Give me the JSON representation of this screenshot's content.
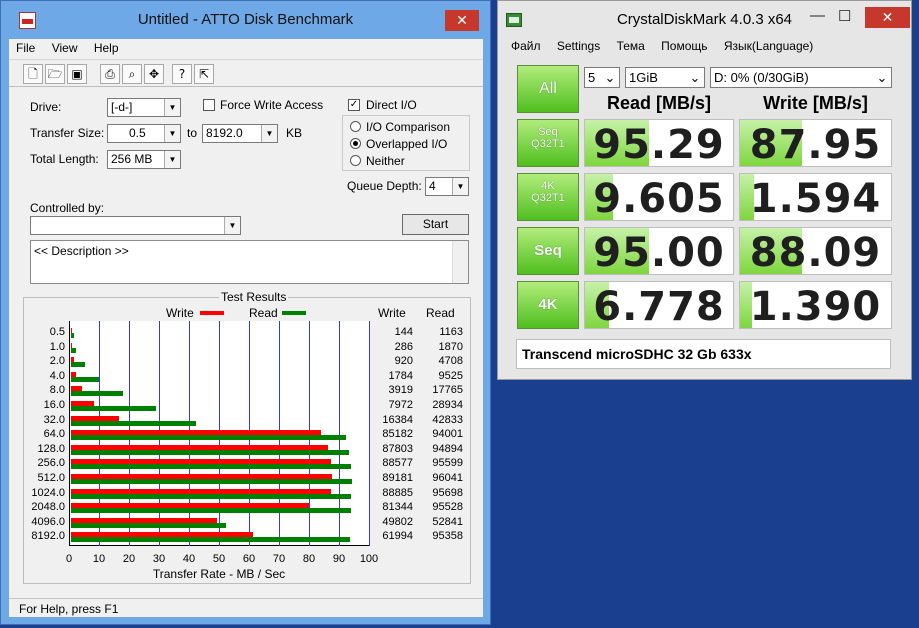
{
  "atto": {
    "title": "Untitled - ATTO Disk Benchmark",
    "close": "✕",
    "menu": [
      "File",
      "View",
      "Help"
    ],
    "toolbar_icons": [
      "new-icon",
      "open-icon",
      "save-icon",
      "print-icon",
      "print-preview-icon",
      "move-icon",
      "help-icon",
      "context-help-icon"
    ],
    "drive_label": "Drive:",
    "drive_value": "[-d-]",
    "transfer_size_label": "Transfer Size:",
    "transfer_from": "0.5",
    "to_label": "to",
    "transfer_to": "8192.0",
    "kb_label": "KB",
    "total_length_label": "Total Length:",
    "total_length_value": "256 MB",
    "force_write_label": "Force Write Access",
    "direct_io_label": "Direct I/O",
    "io_comparison_label": "I/O Comparison",
    "overlapped_io_label": "Overlapped I/O",
    "neither_label": "Neither",
    "queue_depth_label": "Queue Depth:",
    "queue_depth_value": "4",
    "controlled_by_label": "Controlled by:",
    "start_label": "Start",
    "description_text": "<< Description >>",
    "results_title": "Test Results",
    "legend_write": "Write",
    "legend_read": "Read",
    "col_write": "Write",
    "col_read": "Read",
    "xlabel": "Transfer Rate - MB / Sec",
    "status": "For Help, press F1",
    "colors": {
      "write": "#ff0000",
      "read": "#008000",
      "grid": "#3a3ad0"
    }
  },
  "chart_data": {
    "type": "bar",
    "orientation": "horizontal",
    "title": "Test Results",
    "xlabel": "Transfer Rate - MB / Sec",
    "xlim": [
      0,
      100
    ],
    "xticks": [
      "0",
      "10",
      "20",
      "30",
      "40",
      "50",
      "60",
      "70",
      "80",
      "90",
      "100"
    ],
    "categories": [
      "0.5",
      "1.0",
      "2.0",
      "4.0",
      "8.0",
      "16.0",
      "32.0",
      "64.0",
      "128.0",
      "256.0",
      "512.0",
      "1024.0",
      "2048.0",
      "4096.0",
      "8192.0"
    ],
    "series": [
      {
        "name": "Write",
        "color": "#ff0000",
        "values": [
          0.14,
          0.28,
          0.9,
          1.74,
          3.83,
          7.79,
          16.0,
          83.19,
          85.75,
          86.5,
          87.09,
          86.8,
          79.44,
          48.64,
          60.54
        ]
      },
      {
        "name": "Read",
        "color": "#008000",
        "values": [
          1.14,
          1.83,
          4.6,
          9.3,
          17.35,
          28.26,
          41.83,
          91.8,
          92.67,
          93.36,
          93.79,
          93.45,
          93.29,
          51.6,
          93.12
        ]
      }
    ],
    "write_labels": [
      "144",
      "286",
      "920",
      "1784",
      "3919",
      "7972",
      "16384",
      "85182",
      "87803",
      "88577",
      "89181",
      "88885",
      "81344",
      "49802",
      "61994"
    ],
    "read_labels": [
      "1163",
      "1870",
      "4708",
      "9525",
      "17765",
      "28934",
      "42833",
      "94001",
      "94894",
      "95599",
      "96041",
      "95698",
      "95528",
      "52841",
      "95358"
    ],
    "grid": true,
    "legend": "top"
  },
  "cdm": {
    "title": "CrystalDiskMark 4.0.3 x64",
    "minimize": "—",
    "maximize": "☐",
    "close": "✕",
    "menu": [
      "Файл",
      "Settings",
      "Тема",
      "Помощь",
      "Язык(Language)"
    ],
    "all_label": "All",
    "count_value": "5",
    "size_value": "1GiB",
    "drive_value": "D: 0% (0/30GiB)",
    "read_header": "Read [MB/s]",
    "write_header": "Write [MB/s]",
    "rows": [
      {
        "t1": "Seq",
        "t2": "Q32T1",
        "read": "95.29",
        "write": "87.95",
        "read_fill": 0.43,
        "write_fill": 0.41
      },
      {
        "t1": "4K",
        "t2": "Q32T1",
        "read": "9.605",
        "write": "1.594",
        "read_fill": 0.19,
        "write_fill": 0.09
      },
      {
        "t1": "Seq",
        "t2": "",
        "read": "95.00",
        "write": "88.09",
        "read_fill": 0.43,
        "write_fill": 0.41
      },
      {
        "t1": "4K",
        "t2": "",
        "read": "6.778",
        "write": "1.390",
        "read_fill": 0.16,
        "write_fill": 0.08
      }
    ],
    "comment": "Transcend microSDHC 32 Gb 633x"
  }
}
